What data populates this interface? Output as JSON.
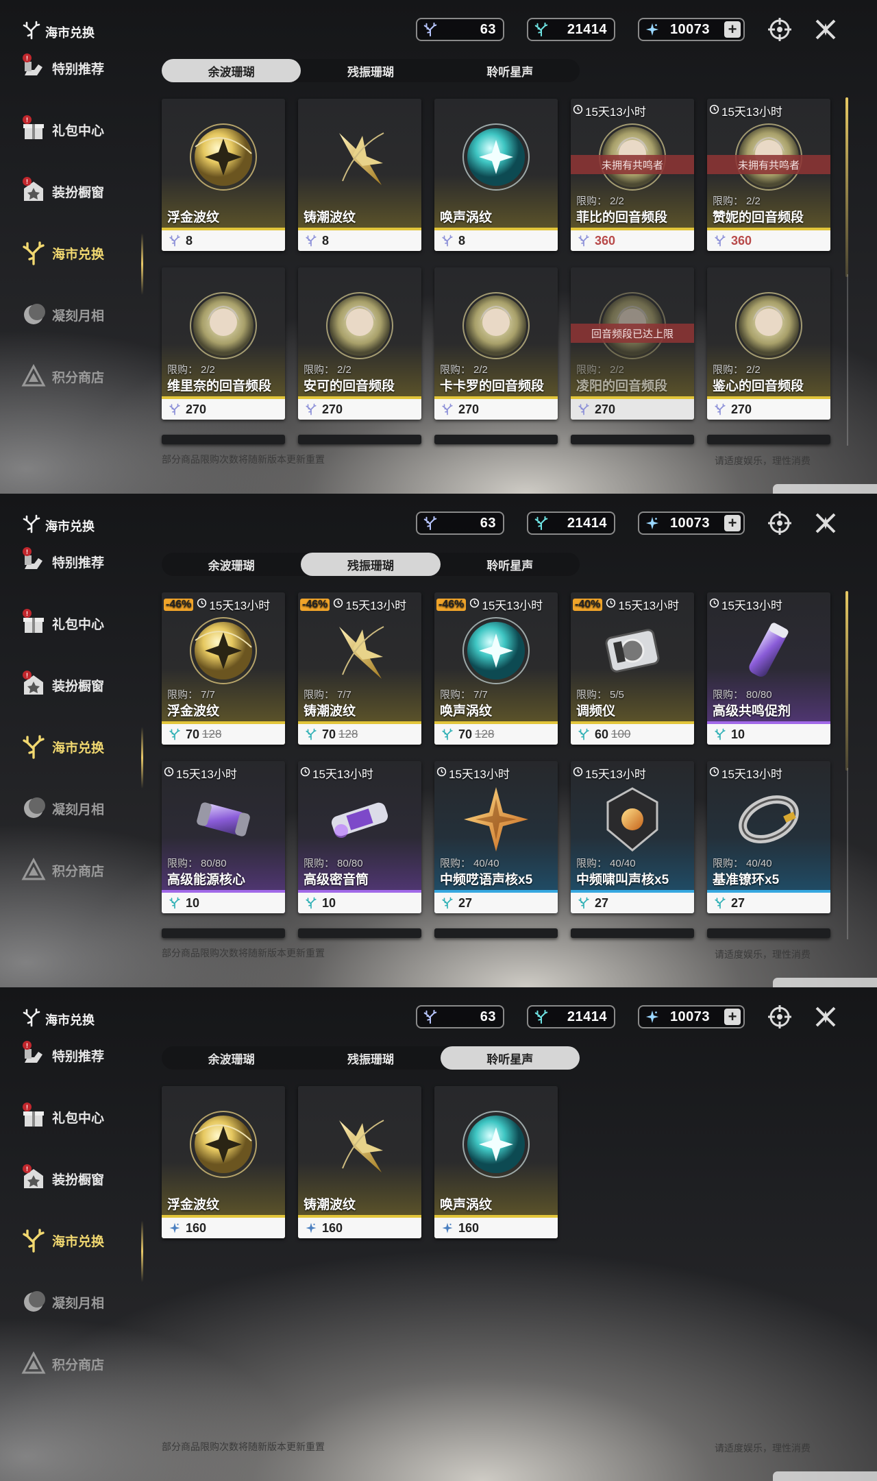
{
  "screens": [
    {
      "title": "海市兑换",
      "currencies": [
        "63",
        "21414",
        "10073"
      ],
      "sidebar": [
        {
          "label": "特别推荐",
          "badge": "!"
        },
        {
          "label": "礼包中心",
          "badge": "!"
        },
        {
          "label": "装扮橱窗",
          "badge": "!"
        },
        {
          "label": "海市兑换",
          "badge": ""
        },
        {
          "label": "凝刻月相",
          "badge": ""
        },
        {
          "label": "积分商店",
          "badge": ""
        }
      ],
      "tabs": [
        "余波珊瑚",
        "残振珊瑚",
        "聆听星声"
      ],
      "selected_tab": 0,
      "items": [
        {
          "name": "浮金波纹",
          "price": "8",
          "limit": "",
          "timer": "",
          "discount": "",
          "old_price": "",
          "overlay": "",
          "theme": "gold"
        },
        {
          "name": "铸潮波纹",
          "price": "8",
          "limit": "",
          "timer": "",
          "discount": "",
          "old_price": "",
          "overlay": "",
          "theme": "gold"
        },
        {
          "name": "唤声涡纹",
          "price": "8",
          "limit": "",
          "timer": "",
          "discount": "",
          "old_price": "",
          "overlay": "",
          "theme": "gold"
        },
        {
          "name": "菲比的回音频段",
          "price": "360",
          "limit": "2/2",
          "timer": "15天13小时",
          "discount": "",
          "old_price": "",
          "overlay": "未拥有共鸣者",
          "theme": "gold"
        },
        {
          "name": "赞妮的回音频段",
          "price": "360",
          "limit": "2/2",
          "timer": "15天13小时",
          "discount": "",
          "old_price": "",
          "overlay": "未拥有共鸣者",
          "theme": "gold"
        },
        {
          "name": "维里奈的回音频段",
          "price": "270",
          "limit": "2/2",
          "timer": "",
          "discount": "",
          "old_price": "",
          "overlay": "",
          "theme": "gold"
        },
        {
          "name": "安可的回音频段",
          "price": "270",
          "limit": "2/2",
          "timer": "",
          "discount": "",
          "old_price": "",
          "overlay": "",
          "theme": "gold"
        },
        {
          "name": "卡卡罗的回音频段",
          "price": "270",
          "limit": "2/2",
          "timer": "",
          "discount": "",
          "old_price": "",
          "overlay": "",
          "theme": "gold"
        },
        {
          "name": "凌阳的回音频段",
          "price": "270",
          "limit": "2/2",
          "timer": "",
          "discount": "",
          "old_price": "",
          "overlay": "回音频段已达上限",
          "theme": "gold"
        },
        {
          "name": "鉴心的回音频段",
          "price": "270",
          "limit": "2/2",
          "timer": "",
          "discount": "",
          "old_price": "",
          "overlay": "",
          "theme": "gold"
        }
      ],
      "footer_left": "部分商品限购次数将随新版本更新重置",
      "footer_right": "请适度娱乐，理性消费"
    },
    {
      "title": "海市兑换",
      "currencies": [
        "63",
        "21414",
        "10073"
      ],
      "sidebar": [
        {
          "label": "特别推荐",
          "badge": "!"
        },
        {
          "label": "礼包中心",
          "badge": "!"
        },
        {
          "label": "装扮橱窗",
          "badge": "!"
        },
        {
          "label": "海市兑换",
          "badge": ""
        },
        {
          "label": "凝刻月相",
          "badge": ""
        },
        {
          "label": "积分商店",
          "badge": ""
        }
      ],
      "tabs": [
        "余波珊瑚",
        "残振珊瑚",
        "聆听星声"
      ],
      "selected_tab": 1,
      "items": [
        {
          "name": "浮金波纹",
          "price": "70",
          "limit": "7/7",
          "timer": "15天13小时",
          "discount": "-46%",
          "old_price": "128",
          "overlay": "",
          "theme": "gold"
        },
        {
          "name": "铸潮波纹",
          "price": "70",
          "limit": "7/7",
          "timer": "15天13小时",
          "discount": "-46%",
          "old_price": "128",
          "overlay": "",
          "theme": "gold"
        },
        {
          "name": "唤声涡纹",
          "price": "70",
          "limit": "7/7",
          "timer": "15天13小时",
          "discount": "-46%",
          "old_price": "128",
          "overlay": "",
          "theme": "gold"
        },
        {
          "name": "调频仪",
          "price": "60",
          "limit": "5/5",
          "timer": "15天13小时",
          "discount": "-40%",
          "old_price": "100",
          "overlay": "",
          "theme": "gold"
        },
        {
          "name": "高级共鸣促剂",
          "price": "10",
          "limit": "80/80",
          "timer": "15天13小时",
          "discount": "",
          "old_price": "",
          "overlay": "",
          "theme": "purple"
        },
        {
          "name": "高级能源核心",
          "price": "10",
          "limit": "80/80",
          "timer": "15天13小时",
          "discount": "",
          "old_price": "",
          "overlay": "",
          "theme": "purple"
        },
        {
          "name": "高级密音筒",
          "price": "10",
          "limit": "80/80",
          "timer": "15天13小时",
          "discount": "",
          "old_price": "",
          "overlay": "",
          "theme": "purple"
        },
        {
          "name": "中频呓语声核x5",
          "price": "27",
          "limit": "40/40",
          "timer": "15天13小时",
          "discount": "",
          "old_price": "",
          "overlay": "",
          "theme": "blue"
        },
        {
          "name": "中频啸叫声核x5",
          "price": "27",
          "limit": "40/40",
          "timer": "15天13小时",
          "discount": "",
          "old_price": "",
          "overlay": "",
          "theme": "blue"
        },
        {
          "name": "基准镣环x5",
          "price": "27",
          "limit": "40/40",
          "timer": "15天13小时",
          "discount": "",
          "old_price": "",
          "overlay": "",
          "theme": "blue"
        }
      ],
      "footer_left": "部分商品限购次数将随新版本更新重置",
      "footer_right": "请适度娱乐，理性消费"
    },
    {
      "title": "海市兑换",
      "currencies": [
        "63",
        "21414",
        "10073"
      ],
      "sidebar": [
        {
          "label": "特别推荐",
          "badge": "!"
        },
        {
          "label": "礼包中心",
          "badge": "!"
        },
        {
          "label": "装扮橱窗",
          "badge": "!"
        },
        {
          "label": "海市兑换",
          "badge": ""
        },
        {
          "label": "凝刻月相",
          "badge": ""
        },
        {
          "label": "积分商店",
          "badge": ""
        }
      ],
      "tabs": [
        "余波珊瑚",
        "残振珊瑚",
        "聆听星声"
      ],
      "selected_tab": 2,
      "items": [
        {
          "name": "浮金波纹",
          "price": "160",
          "limit": "",
          "timer": "",
          "discount": "",
          "old_price": "",
          "overlay": "",
          "theme": "gold"
        },
        {
          "name": "铸潮波纹",
          "price": "160",
          "limit": "",
          "timer": "",
          "discount": "",
          "old_price": "",
          "overlay": "",
          "theme": "gold"
        },
        {
          "name": "唤声涡纹",
          "price": "160",
          "limit": "",
          "timer": "",
          "discount": "",
          "old_price": "",
          "overlay": "",
          "theme": "gold"
        }
      ],
      "footer_left": "部分商品限购次数将随新版本更新重置",
      "footer_right": "请适度娱乐，理性消费"
    }
  ],
  "labels": {
    "limit_prefix": "限购："
  },
  "colors": {
    "accent_gold": "#e2c53a",
    "active_nav": "#f1d870",
    "owned_overlay": "#8c3434",
    "discount": "#f0a42a"
  },
  "icons": {
    "currency_1": "coral-purple-icon",
    "currency_2": "coral-teal-icon",
    "currency_3": "star-sound-icon",
    "top_right": [
      "compass-icon",
      "close-icon"
    ],
    "sidebar": [
      "recommend-icon",
      "gift-icon",
      "wardrobe-icon",
      "coral-tree-icon",
      "moon-phase-icon",
      "points-shop-icon"
    ]
  }
}
